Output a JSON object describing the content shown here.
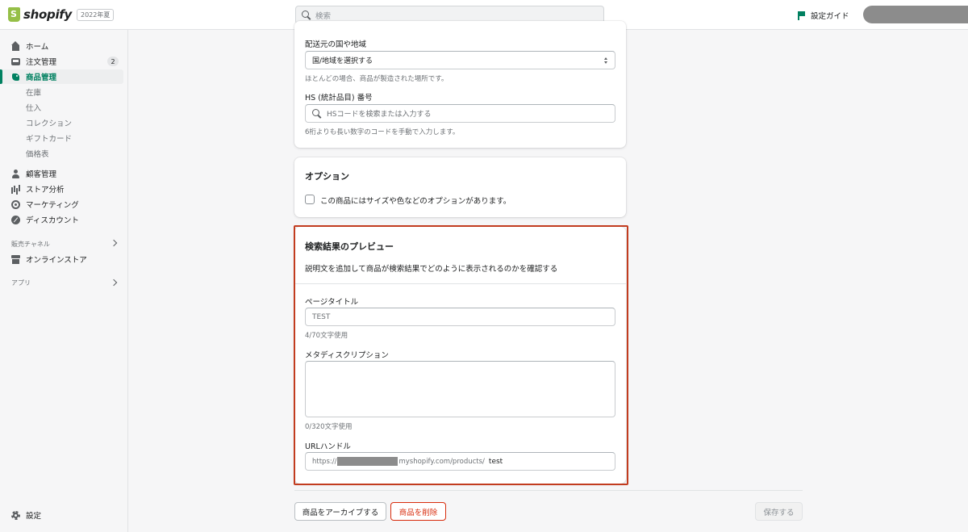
{
  "topbar": {
    "logo_text": "shopify",
    "edition": "2022年夏",
    "search_placeholder": "検索",
    "setup_guide": "設定ガイド"
  },
  "sidebar": {
    "items": [
      {
        "label": "ホーム",
        "icon": "home-icon"
      },
      {
        "label": "注文管理",
        "icon": "inbox-icon",
        "badge": "2"
      },
      {
        "label": "商品管理",
        "icon": "tag-icon",
        "active": true
      },
      {
        "label": "顧客管理",
        "icon": "person-icon"
      },
      {
        "label": "ストア分析",
        "icon": "bar-chart-icon"
      },
      {
        "label": "マーケティング",
        "icon": "target-icon"
      },
      {
        "label": "ディスカウント",
        "icon": "discount-icon"
      }
    ],
    "product_subitems": [
      "在庫",
      "仕入",
      "コレクション",
      "ギフトカード",
      "価格表"
    ],
    "sales_channels_label": "販売チャネル",
    "online_store": "オンラインストア",
    "apps_label": "アプリ",
    "settings": "設定"
  },
  "shipping": {
    "origin_label": "配送元の国や地域",
    "origin_value": "国/地域を選択する",
    "origin_help": "ほとんどの場合、商品が製造された場所です。",
    "hs_label": "HS (統計品目) 番号",
    "hs_placeholder": "HSコードを検索または入力する",
    "hs_help": "6桁よりも長い数字のコードを手動で入力します。"
  },
  "options": {
    "title": "オプション",
    "checkbox_label": "この商品にはサイズや色などのオプションがあります。"
  },
  "seo": {
    "title": "検索結果のプレビュー",
    "description": "説明文を追加して商品が検索結果でどのように表示されるのかを確認する",
    "page_title_label": "ページタイトル",
    "page_title_value": "TEST",
    "page_title_count": "4/70文字使用",
    "meta_label": "メタディスクリプション",
    "meta_value": "",
    "meta_count": "0/320文字使用",
    "url_label": "URLハンドル",
    "url_prefix": "https://",
    "url_mid": "myshopify.com/products/",
    "url_handle": "test"
  },
  "actions": {
    "archive": "商品をアーカイブする",
    "delete": "商品を削除",
    "save": "保存する"
  },
  "colors": {
    "accent": "#008060",
    "highlight": "#c23c1f",
    "danger": "#d82c0d"
  }
}
